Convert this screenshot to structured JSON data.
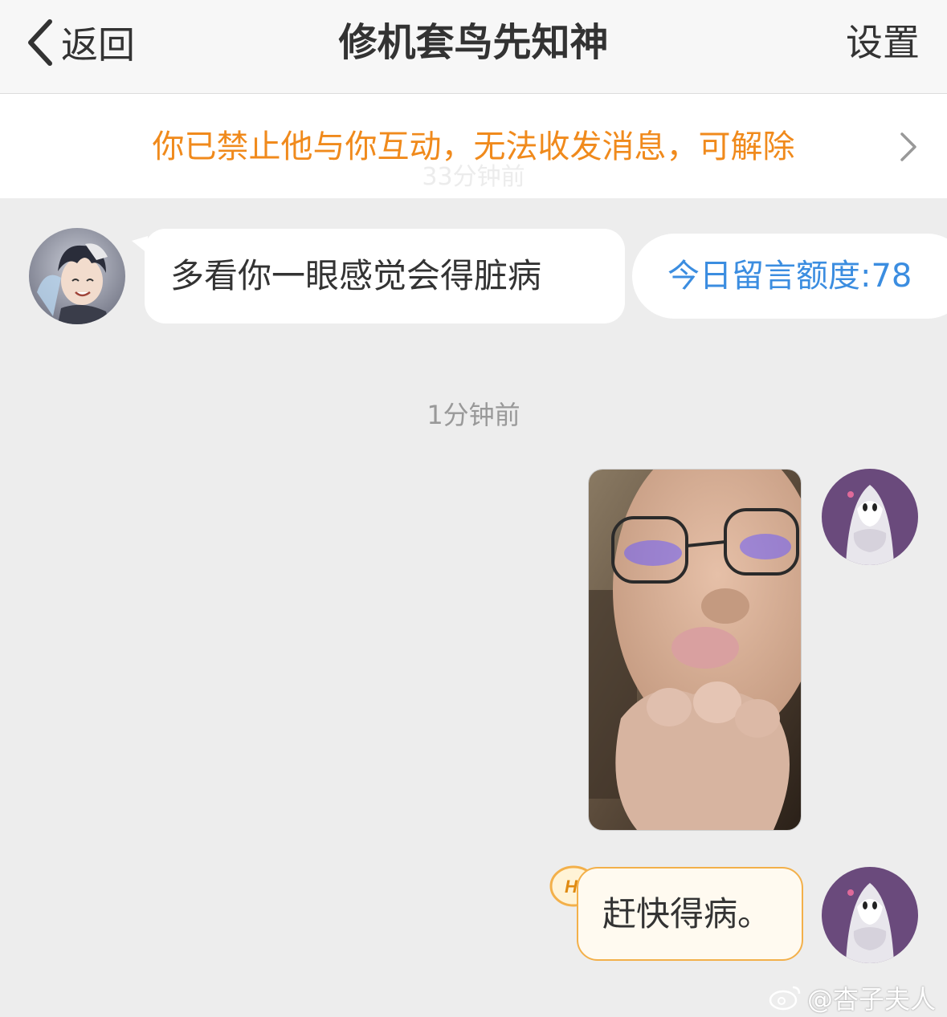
{
  "header": {
    "back_label": "返回",
    "title": "修机套鸟先知神",
    "settings_label": "设置"
  },
  "banner": {
    "text": "你已禁止他与你互动，无法收发消息，可解除",
    "faded_time": "33分钟前"
  },
  "messages": [
    {
      "side": "left",
      "type": "text",
      "text": "多看你一眼感觉会得脏病",
      "avatar_icon": "anime-boy-avatar-icon"
    },
    {
      "type": "timestamp",
      "text": "1分钟前"
    },
    {
      "side": "right",
      "type": "image",
      "avatar_icon": "ghost-bride-avatar-icon"
    },
    {
      "side": "right",
      "type": "text",
      "text": "赶快得病。",
      "badge": "Hi",
      "avatar_icon": "ghost-bride-avatar-icon"
    }
  ],
  "quota": {
    "label": "今日留言额度:78"
  },
  "watermark": {
    "text": "@杏子夫人",
    "icon": "weibo-logo-icon"
  },
  "colors": {
    "banner_text": "#f08a1c",
    "quota_text": "#3b8de0",
    "background": "#ededed",
    "bubble_outline_right": "#f3b04a"
  }
}
